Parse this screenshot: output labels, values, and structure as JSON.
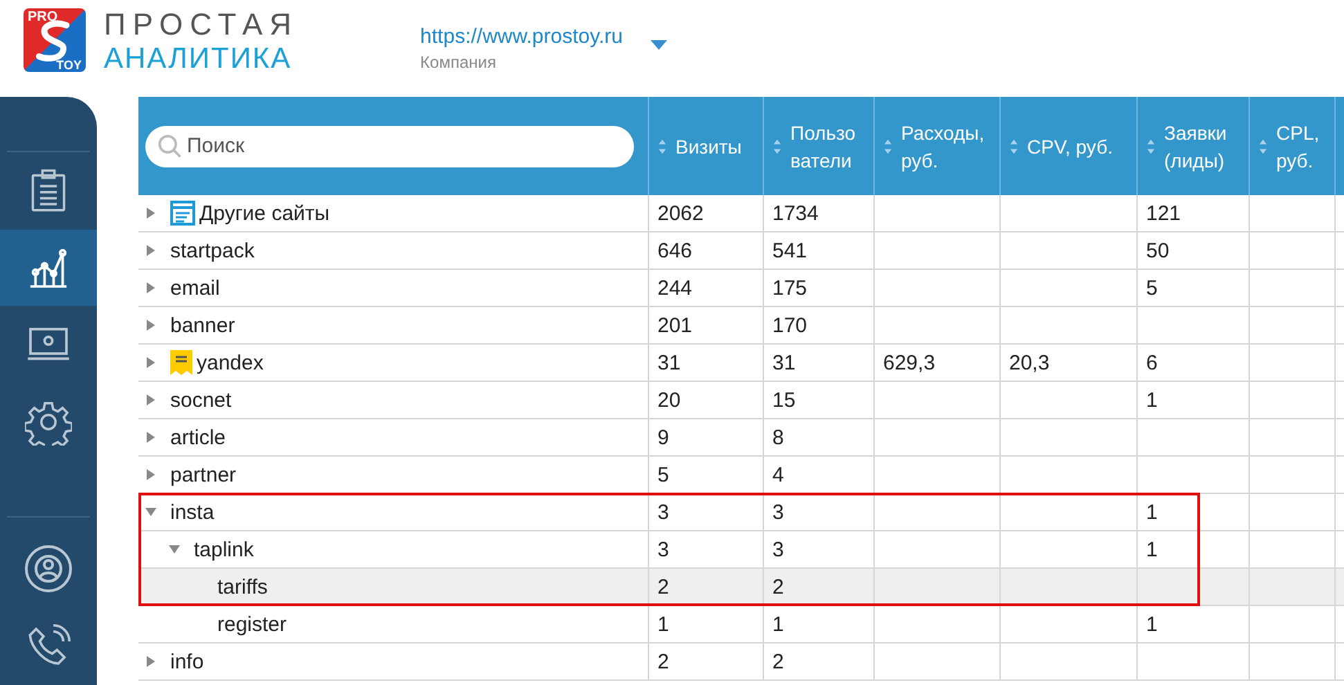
{
  "logo": {
    "badge_top": "PRO",
    "badge_bottom": "TOY",
    "line1": "ПРОСТАЯ",
    "line2": "АНАЛИТИКА"
  },
  "site": {
    "url": "https://www.prostoy.ru",
    "subtitle": "Компания"
  },
  "sidebar": {
    "items": [
      {
        "kind": "clipboard",
        "selected": false
      },
      {
        "kind": "chart",
        "selected": true
      },
      {
        "kind": "laptop",
        "selected": false
      },
      {
        "kind": "gear",
        "selected": false
      },
      {
        "kind": "user",
        "selected": false
      },
      {
        "kind": "phone",
        "selected": false
      }
    ]
  },
  "search": {
    "placeholder": "Поиск"
  },
  "columns": [
    "Визиты",
    "Пользо\nватели",
    "Расходы,\nруб.",
    "CPV, руб.",
    "Заявки\n(лиды)",
    "CPL,\nруб."
  ],
  "rows": [
    {
      "name": "Другие сайты",
      "kind": "site",
      "expanded": false,
      "selected": false,
      "highlighted": false,
      "cells": [
        "2062",
        "1734",
        null,
        null,
        "121",
        null
      ]
    },
    {
      "name": "startpack",
      "expanded": false,
      "selected": false,
      "highlighted": false,
      "cells": [
        "646",
        "541",
        null,
        null,
        "50",
        null
      ]
    },
    {
      "name": "email",
      "expanded": false,
      "selected": false,
      "highlighted": false,
      "cells": [
        "244",
        "175",
        null,
        null,
        "5",
        null
      ]
    },
    {
      "name": "banner",
      "expanded": false,
      "selected": false,
      "highlighted": false,
      "cells": [
        "201",
        "170",
        null,
        null,
        null,
        null
      ]
    },
    {
      "name": "yandex",
      "kind": "yandex",
      "expanded": false,
      "selected": false,
      "highlighted": false,
      "cells": [
        "31",
        "31",
        "629,3",
        "20,3",
        "6",
        null
      ]
    },
    {
      "name": "socnet",
      "expanded": false,
      "selected": false,
      "highlighted": false,
      "cells": [
        "20",
        "15",
        null,
        null,
        "1",
        null
      ]
    },
    {
      "name": "article",
      "expanded": false,
      "selected": false,
      "highlighted": false,
      "cells": [
        "9",
        "8",
        null,
        null,
        null,
        null
      ]
    },
    {
      "name": "partner",
      "expanded": false,
      "selected": false,
      "highlighted": false,
      "cells": [
        "5",
        "4",
        null,
        null,
        null,
        null
      ]
    },
    {
      "name": "insta",
      "expanded": true,
      "selected": false,
      "highlighted": true,
      "cells": [
        "3",
        "3",
        null,
        null,
        "1",
        null
      ],
      "children": [
        {
          "name": "taplink",
          "expanded": true,
          "selected": false,
          "highlighted": true,
          "cells": [
            "3",
            "3",
            null,
            null,
            "1",
            null
          ],
          "children": [
            {
              "name": "tariffs",
              "selected": true,
              "highlighted": true,
              "cells": [
                "2",
                "2",
                null,
                null,
                null,
                null
              ]
            },
            {
              "name": "register",
              "selected": false,
              "highlighted": false,
              "cells": [
                "1",
                "1",
                null,
                null,
                "1",
                null
              ]
            }
          ]
        }
      ]
    },
    {
      "name": "info",
      "expanded": false,
      "selected": false,
      "highlighted": false,
      "cells": [
        "2",
        "2",
        null,
        null,
        null,
        null
      ]
    }
  ]
}
